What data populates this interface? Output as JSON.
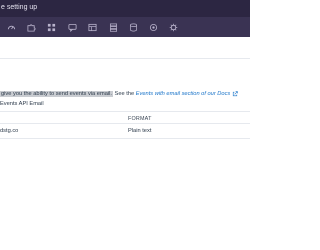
{
  "header": {
    "title": "e setting up"
  },
  "navbar": {
    "icons": [
      "speedometer-icon",
      "puzzle-icon",
      "grid-icon",
      "chat-icon",
      "table-icon",
      "stack-icon",
      "database-icon",
      "settings-icon",
      "gear-icon"
    ]
  },
  "content": {
    "intro_highlight": "give you the ability to send events via email.",
    "intro_see": " See the ",
    "intro_link": "Events with email section of our Docs",
    "api_label": "Events API Email"
  },
  "table": {
    "headers": [
      "",
      "FORMAT"
    ],
    "rows": [
      {
        "email": "dstg.co",
        "format": "Plain text"
      }
    ]
  },
  "colors": {
    "topbar": "#2c2642",
    "navbar": "#3a3353",
    "link": "#1a74c9",
    "highlight": "#c9ccd1"
  }
}
